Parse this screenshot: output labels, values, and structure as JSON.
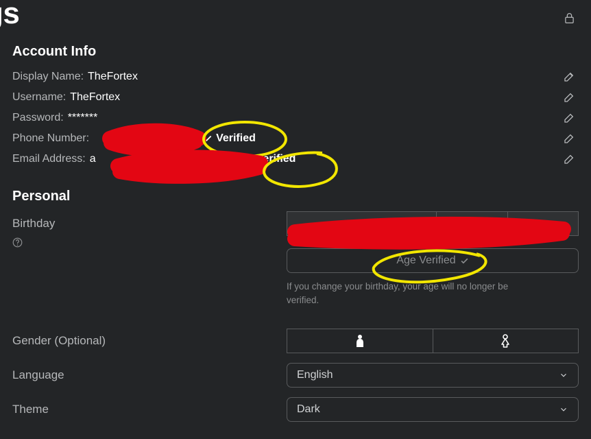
{
  "pageTitle": "gs",
  "sections": {
    "account": {
      "title": "Account Info"
    },
    "personal": {
      "title": "Personal"
    }
  },
  "account": {
    "displayName": {
      "label": "Display Name:",
      "value": "TheFortex"
    },
    "username": {
      "label": "Username:",
      "value": "TheFortex"
    },
    "password": {
      "label": "Password:",
      "value": "*******"
    },
    "phone": {
      "label": "Phone Number:",
      "value": "",
      "verified": "Verified"
    },
    "email": {
      "label": "Email Address:",
      "value": "a",
      "verified": "Verified"
    }
  },
  "personal": {
    "birthday": {
      "label": "Birthday",
      "ageVerified": "Age Verified",
      "help": "If you change your birthday, your age will no longer be verified."
    },
    "gender": {
      "label": "Gender (Optional)"
    },
    "language": {
      "label": "Language",
      "value": "English"
    },
    "theme": {
      "label": "Theme",
      "value": "Dark"
    }
  }
}
